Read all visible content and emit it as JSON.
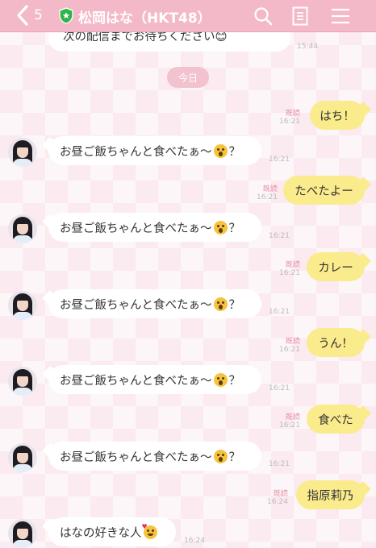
{
  "header": {
    "back_count": "5",
    "title": "松岡はな（HKT48）"
  },
  "date_divider": "今日",
  "top_message": {
    "text": "次の配信までお待ちください😊",
    "time": "15:44"
  },
  "messages": [
    {
      "side": "out",
      "text": "はち！",
      "read": "既読",
      "time": "16:21"
    },
    {
      "side": "in",
      "text": "お昼ご飯ちゃんと食べたぁ〜",
      "suffix": "？",
      "time": "16:21"
    },
    {
      "side": "out",
      "text": "たべたよー",
      "read": "既読",
      "time": "16:21"
    },
    {
      "side": "in",
      "text": "お昼ご飯ちゃんと食べたぁ〜",
      "suffix": "？",
      "time": "16:21"
    },
    {
      "side": "out",
      "text": "カレー",
      "read": "既読",
      "time": "16:21"
    },
    {
      "side": "in",
      "text": "お昼ご飯ちゃんと食べたぁ〜",
      "suffix": "？",
      "time": "16:21"
    },
    {
      "side": "out",
      "text": "うん！",
      "read": "既読",
      "time": "16:21"
    },
    {
      "side": "in",
      "text": "お昼ご飯ちゃんと食べたぁ〜",
      "suffix": "？",
      "time": "16:21"
    },
    {
      "side": "out",
      "text": "食べた",
      "read": "既読",
      "time": "16:21"
    },
    {
      "side": "in",
      "text": "お昼ご飯ちゃんと食べたぁ〜",
      "suffix": "？",
      "time": "16:21"
    },
    {
      "side": "out",
      "text": "指原莉乃",
      "read": "既読",
      "time": "16:24"
    },
    {
      "side": "in",
      "text": "はなの好きな人",
      "suffix": "",
      "time": "16:24"
    }
  ],
  "icons": {
    "back": "chevron-left-icon",
    "verified": "shield-star-icon",
    "search": "search-icon",
    "notes": "note-icon",
    "menu": "hamburger-menu-icon"
  },
  "colors": {
    "header": "#f4b9c8",
    "outgoing_bubble": "#faeb8c",
    "incoming_bubble": "#ffffff",
    "read_label": "#e58da3"
  }
}
